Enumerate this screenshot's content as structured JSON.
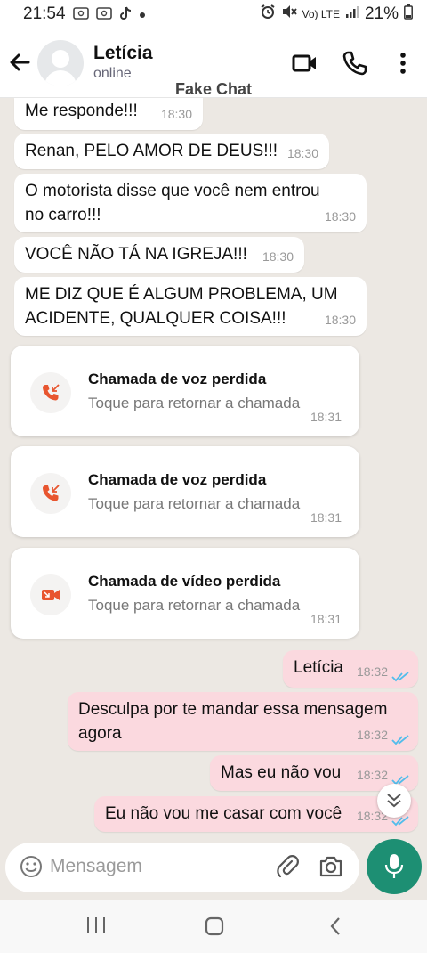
{
  "status_bar": {
    "time": "21:54",
    "left_icons": [
      "screenshot-icon",
      "screenshot-icon",
      "tiktok-icon",
      "dot-icon"
    ],
    "network": "Vo) LTE",
    "battery": "21%"
  },
  "header": {
    "contact_name": "Letícia",
    "contact_status": "online",
    "watermark": "Fake Chat",
    "icons": [
      "back-arrow-icon",
      "video-call-icon",
      "phone-icon",
      "more-vert-icon"
    ]
  },
  "messages": [
    {
      "direction": "in",
      "text": "Me responde!!!",
      "time": "18:30"
    },
    {
      "direction": "in",
      "text": "Renan, PELO AMOR DE DEUS!!!",
      "time": "18:30"
    },
    {
      "direction": "in",
      "text_lines": [
        "O motorista disse que você nem entrou",
        "no carro!!!"
      ],
      "time": "18:30"
    },
    {
      "direction": "in",
      "text": "VOCÊ NÃO TÁ NA IGREJA!!!",
      "time": "18:30"
    },
    {
      "direction": "in",
      "text_lines": [
        "ME DIZ QUE É ALGUM PROBLEMA, UM",
        "ACIDENTE, QUALQUER COISA!!!"
      ],
      "time": "18:30"
    }
  ],
  "missed_calls": [
    {
      "title": "Chamada de voz perdida",
      "subtitle": "Toque para retornar a chamada",
      "time": "18:31",
      "icon": "missed-voice-call-icon"
    },
    {
      "title": "Chamada de voz perdida",
      "subtitle": "Toque para retornar a chamada",
      "time": "18:31",
      "icon": "missed-voice-call-icon"
    },
    {
      "title": "Chamada de vídeo perdida",
      "subtitle": "Toque para retornar a chamada",
      "time": "18:31",
      "icon": "missed-video-call-icon"
    }
  ],
  "sent_messages": [
    {
      "direction": "out",
      "text": "Letícia",
      "time": "18:32",
      "status": "read"
    },
    {
      "direction": "out",
      "text_lines": [
        "Desculpa por te mandar essa mensagem",
        "agora"
      ],
      "time": "18:32",
      "status": "read"
    },
    {
      "direction": "out",
      "text": "Mas eu não vou",
      "time": "18:32",
      "status": "read"
    },
    {
      "direction": "out",
      "text": "Eu não vou me casar com você",
      "time": "18:32",
      "status": "read"
    }
  ],
  "composer": {
    "placeholder": "Mensagem",
    "icons": [
      "emoji-icon",
      "attach-icon",
      "camera-icon",
      "mic-icon"
    ]
  },
  "colors": {
    "chat_background": "#ece8e3",
    "incoming_bubble": "#ffffff",
    "outgoing_bubble": "#fbd9df",
    "read_ticks": "#53bdeb",
    "missed_call": "#e8552f",
    "mic_button": "#1d8f73"
  }
}
